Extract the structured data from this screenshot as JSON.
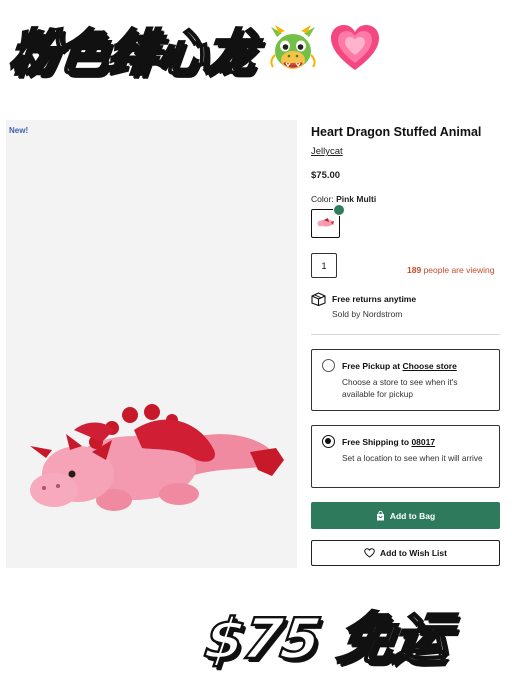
{
  "banner": {
    "title": "粉色绯心龙",
    "emojis": [
      "dragon-face-emoji",
      "growing-heart-emoji"
    ],
    "price_text": "$75 免运"
  },
  "image": {
    "badge": "New!",
    "alt": "dragon-plush-photo"
  },
  "product": {
    "title": "Heart Dragon Stuffed Animal",
    "brand": "Jellycat",
    "price": "$75.00",
    "color_label": "Color:",
    "color_value": "Pink Multi"
  },
  "purchase": {
    "quantity": "1",
    "viewers_count": "189",
    "viewers_text": "people are viewing"
  },
  "returns": {
    "title": "Free returns anytime",
    "sold_by": "Sold by Nordstrom"
  },
  "fulfillment": {
    "pickup": {
      "label": "Free Pickup at",
      "link": "Choose store",
      "body": "Choose a store to see when it's available for pickup",
      "selected": false
    },
    "shipping": {
      "label": "Free Shipping to",
      "link": "08017",
      "body": "Set a location to see when it will arrive",
      "selected": true
    }
  },
  "actions": {
    "add_to_bag": "Add to Bag",
    "add_to_wishlist": "Add to Wish List"
  },
  "colors": {
    "accent_green": "#2d7a5c",
    "viewing_orange": "#c64b2a",
    "dragon_pink": "#f08aa0",
    "dragon_red": "#c8192b"
  }
}
